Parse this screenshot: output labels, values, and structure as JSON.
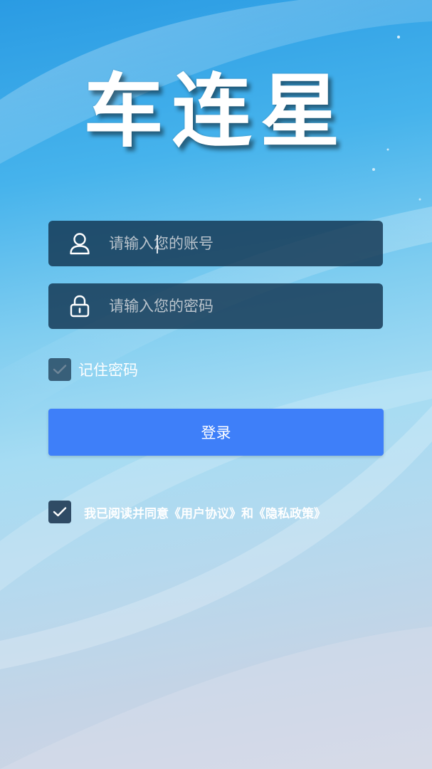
{
  "app": {
    "title": "车连星"
  },
  "login_form": {
    "account_placeholder": "请输入您的账号",
    "password_placeholder": "请输入您的密码",
    "account_icon": "user-icon",
    "password_icon": "lock-icon"
  },
  "remember": {
    "label": "记住密码",
    "checked": true
  },
  "login_button": {
    "label": "登录",
    "color": "#3e7ff9"
  },
  "agreement": {
    "label": "我已阅读并同意《用户协议》和《隐私政策》",
    "checked": true
  },
  "theme": {
    "field_bg": "#123450",
    "text_color": "#ffffff",
    "placeholder_color": "#b9c3cc"
  }
}
